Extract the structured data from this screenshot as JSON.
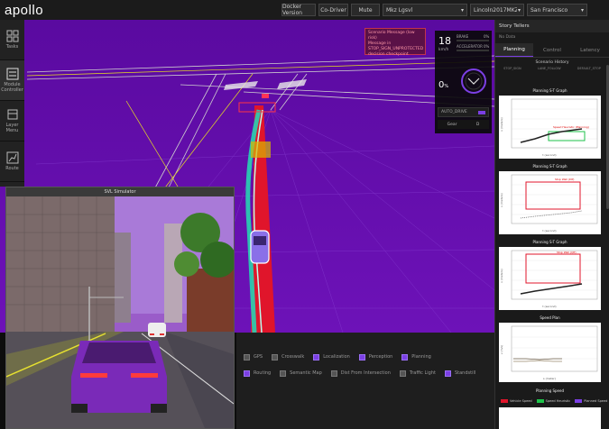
{
  "header": {
    "logo": "apollo",
    "docker_version": "Docker Version",
    "co_driver": "Co-Driver",
    "mute": "Mute",
    "mode_select": "Mkz Lgsvl",
    "vehicle_select": "Lincoln2017MKZ_LGSVL",
    "map_select": "San Francisco"
  },
  "sidenav": {
    "items": [
      {
        "label": "Tasks"
      },
      {
        "label": "Module Controller"
      },
      {
        "label": "Layer Menu"
      },
      {
        "label": "Route"
      }
    ]
  },
  "alert": {
    "line1": "Scenario Message (low risk)",
    "line2": "Message in STOP_SIGN_UNPROTECTED",
    "line3": "decision checkpoint"
  },
  "status": {
    "speed": "18",
    "speed_unit": "km/h",
    "brake_label": "BRAKE",
    "brake_pct": "0%",
    "accel_label": "ACCELERATOR",
    "accel_pct": "0%",
    "steer": "0",
    "steer_unit": "%",
    "driving_mode": "AUTO_DRIVE",
    "gear_label": "Gear",
    "gear_value": "D"
  },
  "video": {
    "title": "SVL Simulator"
  },
  "legend": {
    "items": [
      {
        "label": "GPS",
        "checked": false
      },
      {
        "label": "Crosswalk",
        "checked": false
      },
      {
        "label": "Localization",
        "checked": true
      },
      {
        "label": "Perception",
        "checked": true
      },
      {
        "label": "Planning",
        "checked": true
      },
      {
        "label": "Routing",
        "checked": true
      },
      {
        "label": "Semantic Map",
        "checked": false
      },
      {
        "label": "Dist From Intersection",
        "checked": false
      },
      {
        "label": "Traffic Light",
        "checked": false
      },
      {
        "label": "Standstill",
        "checked": true
      }
    ]
  },
  "rpanel": {
    "title": "Story Tellers",
    "subtitle": "No Data",
    "tabs": [
      {
        "label": "Planning",
        "active": true
      },
      {
        "label": "Control",
        "active": false
      },
      {
        "label": "Latency",
        "active": false
      }
    ],
    "scenario_title": "Scenario History",
    "scenario_cells": [
      "STOP_SIGN",
      "LANE_FOLLOW",
      "DEFAULT_STOP"
    ],
    "charts": [
      {
        "title": "Planning S-T Graph",
        "xlabel": "t (second)",
        "ylabel": "s (meters)",
        "xticks": [
          "0",
          "1",
          "2",
          "3",
          "4",
          "5",
          "6",
          "7",
          "8"
        ],
        "yticks": [
          "0",
          "10",
          "20",
          "30",
          "40",
          "50"
        ],
        "note": "Speed Heuristic (Planning)"
      },
      {
        "title": "Planning S-T Graph",
        "xlabel": "t (second)",
        "ylabel": "s (meters)",
        "xticks": [
          "0",
          "1",
          "2",
          "3",
          "4",
          "5",
          "6",
          "7",
          "8"
        ],
        "yticks": [
          "0",
          "10",
          "20",
          "30",
          "40",
          "50"
        ],
        "note": "Stop Wall (DP)"
      },
      {
        "title": "Planning S-T Graph",
        "xlabel": "t (second)",
        "ylabel": "s (meters)",
        "xticks": [
          "0",
          "1",
          "2",
          "3",
          "4",
          "5",
          "6",
          "7",
          "8"
        ],
        "yticks": [
          "0",
          "10",
          "20",
          "30",
          "40",
          "50"
        ],
        "note": "Stop Wall (QP)"
      },
      {
        "title": "Speed Plan",
        "xlabel": "s (meter)",
        "ylabel": "v (m/s)",
        "xticks": [
          "0",
          "10",
          "20",
          "30",
          "40",
          "50",
          "60",
          "70",
          "80"
        ],
        "yticks": [
          "0",
          "5",
          "10",
          "15",
          "20"
        ],
        "note": ""
      }
    ],
    "bottom_chart_title": "Planning Speed",
    "bottom_legend": [
      "Vehicle Speed",
      "Speed Heuristic",
      "Planned Speed"
    ]
  },
  "colors": {
    "accent": "#7b3fe4",
    "sky": "#6a0fb0",
    "route": "#e0152b",
    "trajectory": "#27d3b3"
  }
}
